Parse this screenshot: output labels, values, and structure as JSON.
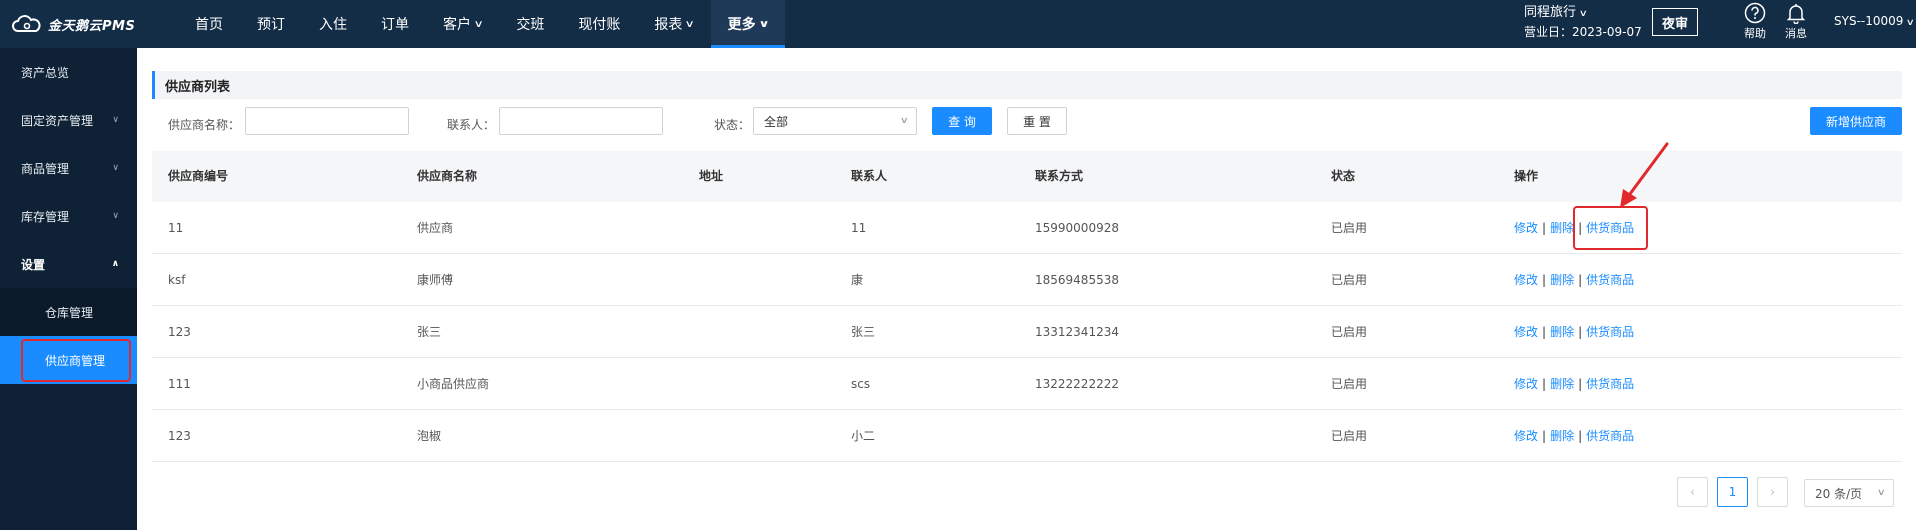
{
  "brand": {
    "name": "金天鹅云PMS"
  },
  "nav": {
    "items": [
      {
        "label": "首页",
        "chevron": false
      },
      {
        "label": "预订",
        "chevron": false
      },
      {
        "label": "入住",
        "chevron": false
      },
      {
        "label": "订单",
        "chevron": false
      },
      {
        "label": "客户",
        "chevron": true
      },
      {
        "label": "交班",
        "chevron": false
      },
      {
        "label": "现付账",
        "chevron": false
      },
      {
        "label": "报表",
        "chevron": true
      },
      {
        "label": "更多",
        "chevron": true,
        "active": true
      }
    ]
  },
  "header": {
    "hotel_name": "同程旅行",
    "business_date_label": "营业日：2023-09-07",
    "night_audit": "夜审",
    "help": "帮助",
    "messages": "消息",
    "user": "SYS--10009"
  },
  "sidebar": {
    "items": [
      {
        "label": "资产总览"
      },
      {
        "label": "固定资产管理"
      },
      {
        "label": "商品管理"
      },
      {
        "label": "库存管理"
      },
      {
        "label": "设置"
      },
      {
        "label": "仓库管理"
      },
      {
        "label": "供应商管理"
      }
    ]
  },
  "page": {
    "title": "供应商列表",
    "filters": {
      "name_label": "供应商名称：",
      "name_value": "",
      "contact_label": "联系人：",
      "contact_value": "",
      "status_label": "状态：",
      "status_value": "全部"
    },
    "buttons": {
      "query": "查 询",
      "reset": "重 置",
      "add": "新增供应商"
    }
  },
  "table": {
    "columns": [
      "供应商编号",
      "供应商名称",
      "地址",
      "联系人",
      "联系方式",
      "状态",
      "操作"
    ],
    "rows": [
      {
        "code": "11",
        "name": "供应商",
        "address": "",
        "contact": "11",
        "phone": "15990000928",
        "status": "已启用"
      },
      {
        "code": "ksf",
        "name": "康师傅",
        "address": "",
        "contact": "康",
        "phone": "18569485538",
        "status": "已启用"
      },
      {
        "code": "123",
        "name": "张三",
        "address": "",
        "contact": "张三",
        "phone": "13312341234",
        "status": "已启用"
      },
      {
        "code": "111",
        "name": "小商品供应商",
        "address": "",
        "contact": "scs",
        "phone": "13222222222",
        "status": "已启用"
      },
      {
        "code": "123",
        "name": "泡椒",
        "address": "",
        "contact": "小二",
        "phone": "",
        "status": "已启用"
      }
    ],
    "ops": {
      "edit": "修改",
      "delete": "删除",
      "supply": "供货商品",
      "sep": "|"
    }
  },
  "pagination": {
    "current": "1",
    "page_size": "20 条/页",
    "prev": "‹",
    "next": "›"
  },
  "colors": {
    "topbar": "#132d47",
    "sidebar": "#0f2235",
    "accent": "#1a8cff",
    "highlight": "#e0292c"
  }
}
